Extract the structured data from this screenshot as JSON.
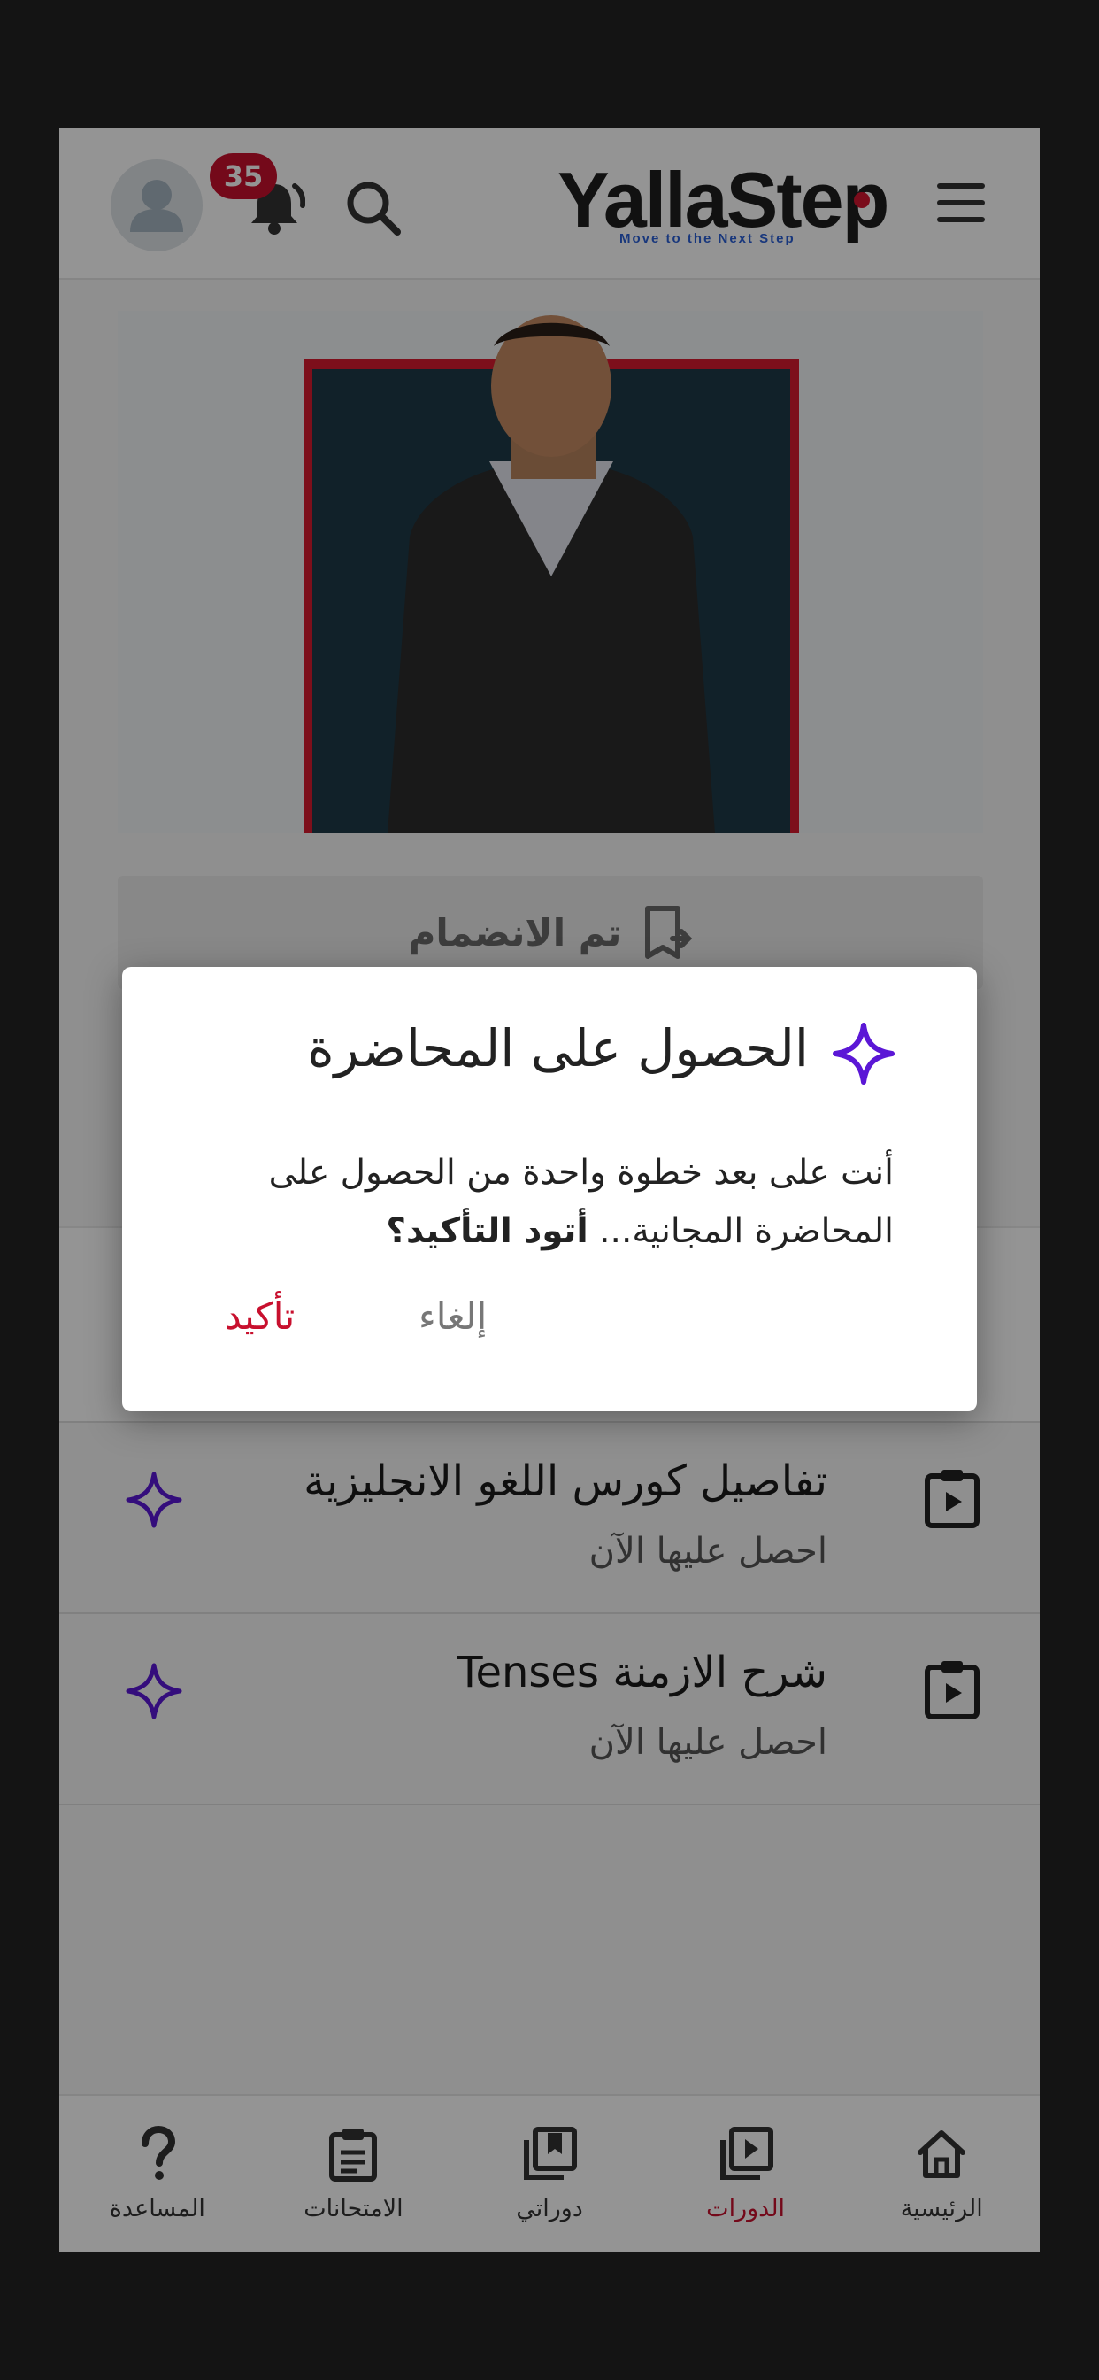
{
  "header": {
    "logo_text": "YallaStep",
    "logo_tagline": "Move to the Next Step",
    "notification_count": "35"
  },
  "course": {
    "joined_label": "تم الانضمام"
  },
  "lectures": [
    {
      "title": "تفاصيل كورس اللغو الانجليزية",
      "subtitle": "احصل عليها الآن"
    },
    {
      "title": "شرح الازمنة Tenses",
      "subtitle": "احصل عليها الآن"
    }
  ],
  "bottom_nav": {
    "items": [
      {
        "label": "الرئيسية",
        "icon": "home-icon",
        "active": false
      },
      {
        "label": "الدورات",
        "icon": "play-library-icon",
        "active": true
      },
      {
        "label": "دوراتي",
        "icon": "bookmark-library-icon",
        "active": false
      },
      {
        "label": "الامتحانات",
        "icon": "clipboard-icon",
        "active": false
      },
      {
        "label": "المساعدة",
        "icon": "question-icon",
        "active": false
      }
    ]
  },
  "dialog": {
    "title": "الحصول على المحاضرة",
    "body_text": "أنت على بعد خطوة واحدة من الحصول على المحاضرة المجانية...",
    "body_emphasis": "أتود التأكيد؟",
    "cancel_label": "إلغاء",
    "confirm_label": "تأكيد"
  },
  "colors": {
    "accent_red": "#c8102e",
    "spark_purple": "#5b17d6"
  }
}
